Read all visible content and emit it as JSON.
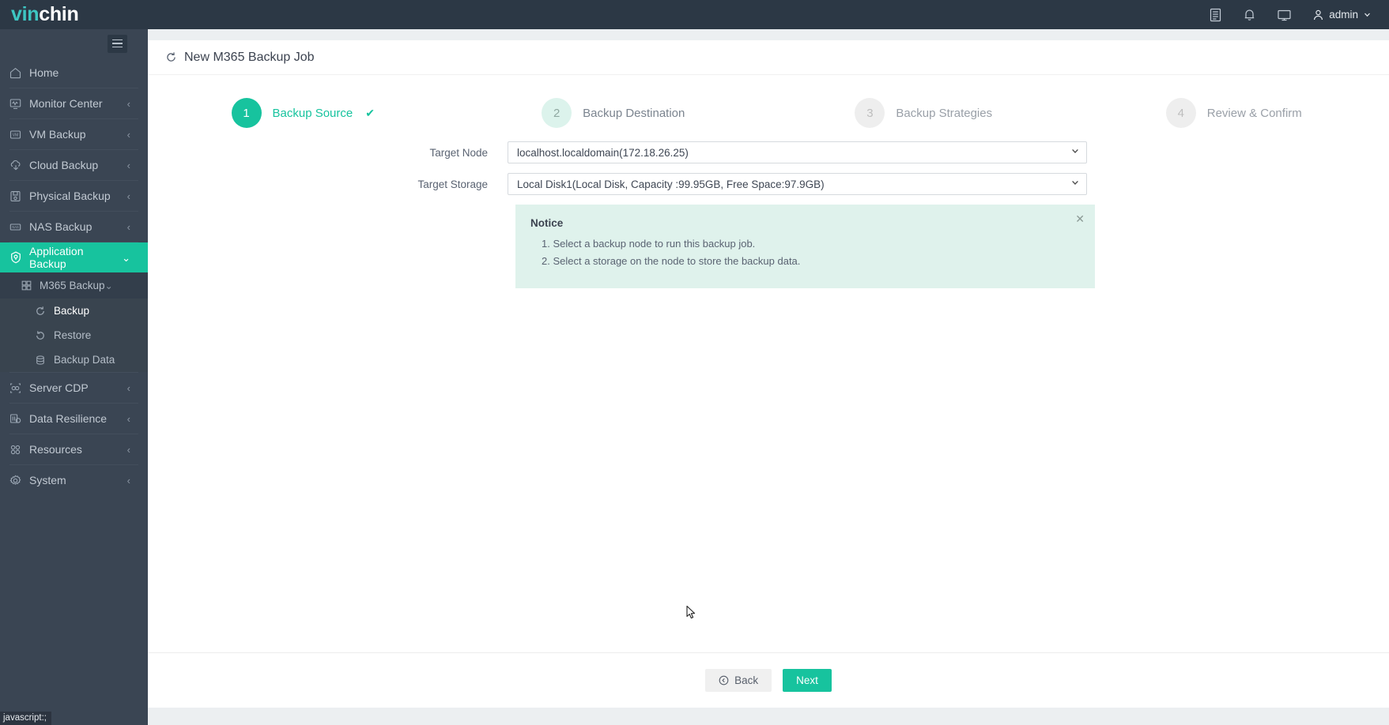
{
  "brand": {
    "logo_part_a": "vin",
    "logo_part_b": "chin"
  },
  "header": {
    "icons": [
      {
        "name": "document-icon",
        "glyph": "document"
      },
      {
        "name": "bell-icon",
        "glyph": "bell"
      },
      {
        "name": "monitor-icon",
        "glyph": "monitor"
      }
    ],
    "user_label": "admin"
  },
  "sidebar": {
    "items": [
      {
        "label": "Home",
        "icon": "home-icon",
        "arrow": "",
        "state": "normal"
      },
      {
        "label": "Monitor Center",
        "icon": "monitor-center-icon",
        "arrow": "‹",
        "state": "normal"
      },
      {
        "label": "VM Backup",
        "icon": "vm-icon",
        "arrow": "‹",
        "state": "normal"
      },
      {
        "label": "Cloud Backup",
        "icon": "cloud-icon",
        "arrow": "‹",
        "state": "normal"
      },
      {
        "label": "Physical Backup",
        "icon": "disk-icon",
        "arrow": "‹",
        "state": "normal"
      },
      {
        "label": "NAS Backup",
        "icon": "nas-icon",
        "arrow": "‹",
        "state": "normal"
      },
      {
        "label": "Application Backup",
        "icon": "shield-icon",
        "arrow": "⌄",
        "state": "active"
      }
    ],
    "sub_items": [
      {
        "label": "M365 Backup",
        "icon": "grid-icon",
        "arrow": "⌄",
        "level": 2
      },
      {
        "label": "Backup",
        "icon": "refresh-cw-icon",
        "level": 3,
        "current": true
      },
      {
        "label": "Restore",
        "icon": "restore-ccw-icon",
        "level": 3,
        "current": false
      },
      {
        "label": "Backup Data",
        "icon": "database-icon",
        "level": 3,
        "current": false
      }
    ],
    "items_after": [
      {
        "label": "Server CDP",
        "icon": "server-cdp-icon",
        "arrow": "‹",
        "state": "normal"
      },
      {
        "label": "Data Resilience",
        "icon": "resilience-icon",
        "arrow": "‹",
        "state": "normal"
      },
      {
        "label": "Resources",
        "icon": "resources-icon",
        "arrow": "‹",
        "state": "normal"
      },
      {
        "label": "System",
        "icon": "gear-icon",
        "arrow": "‹",
        "state": "normal"
      }
    ]
  },
  "page": {
    "title": "New M365 Backup Job",
    "title_icon": "refresh-cw-icon"
  },
  "stepper": {
    "steps": [
      {
        "num": "1",
        "label": "Backup Source",
        "state": "done",
        "check": "✔"
      },
      {
        "num": "2",
        "label": "Backup Destination",
        "state": "next",
        "check": ""
      },
      {
        "num": "3",
        "label": "Backup Strategies",
        "state": "idle",
        "check": ""
      },
      {
        "num": "4",
        "label": "Review & Confirm",
        "state": "idle",
        "check": ""
      }
    ]
  },
  "form": {
    "target_node": {
      "label": "Target Node",
      "value": "localhost.localdomain(172.18.26.25)"
    },
    "target_storage": {
      "label": "Target Storage",
      "value": "Local Disk1(Local Disk, Capacity :99.95GB, Free Space:97.9GB)"
    }
  },
  "notice": {
    "title": "Notice",
    "lines": [
      "1. Select a backup node to run this backup job.",
      "2. Select a storage on the node to store the backup data."
    ],
    "close_glyph": "✕"
  },
  "footer": {
    "back_label": "Back",
    "back_icon": "arrow-left-circle-icon",
    "next_label": "Next"
  },
  "status_tip": {
    "text": "javascript:;"
  },
  "colors": {
    "accent": "#17c39e",
    "sidebar_bg": "#3a4553",
    "topbar_bg": "#2c3845",
    "notice_bg": "#dff2ec",
    "logo_teal": "#3dc6c3"
  }
}
